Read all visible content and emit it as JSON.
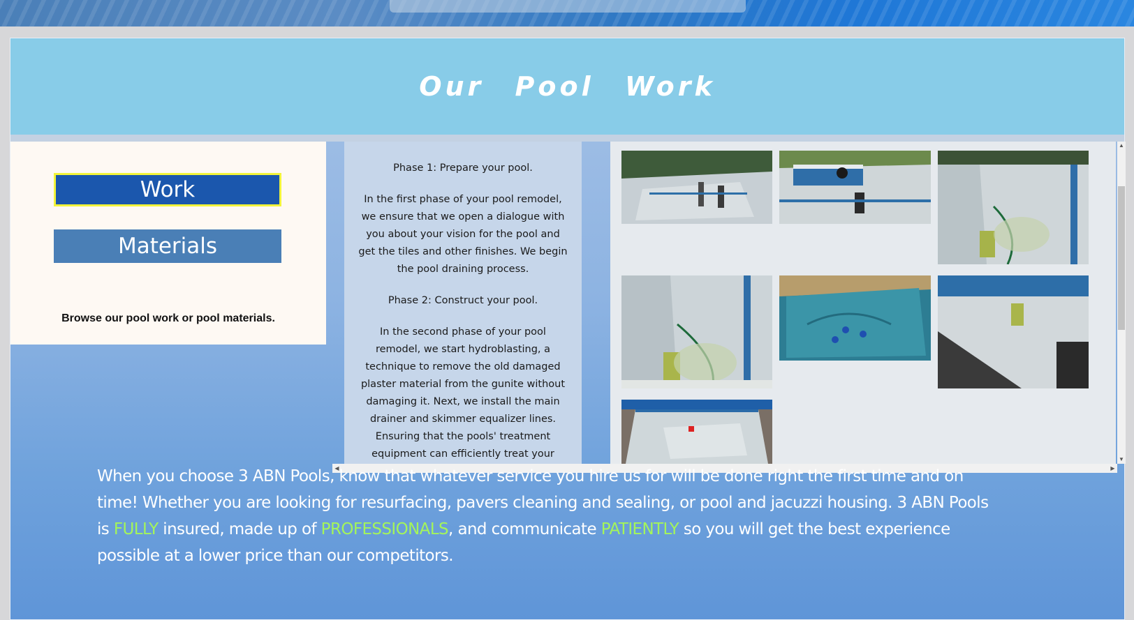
{
  "hero": {
    "title": "Our Pool Work"
  },
  "left": {
    "buttons": {
      "work": "Work",
      "materials": "Materials"
    },
    "browse_text": "Browse our pool work or pool materials."
  },
  "phases": [
    {
      "title": "Phase 1: Prepare your pool.",
      "body": "In the first phase of your pool remodel, we ensure that we open a dialogue with you about your vision for the pool and get the tiles and other finishes. We begin the pool draining process."
    },
    {
      "title": "Phase 2: Construct your pool.",
      "body": "In the second phase of your pool remodel, we start hydroblasting, a technique to remove the old damaged plaster material from the gunite without damaging it. Next, we install the main drainer and skimmer equalizer lines. Ensuring that the pools' treatment equipment can efficiently treat your pool's water."
    }
  ],
  "bottom": {
    "p1": "When you choose 3 ABN Pools, know that whatever service you hire us for will be done right the first time and on time! Whether you are looking for resurfacing, pavers cleaning and sealing, or pool and jacuzzi housing. 3 ABN Pools is ",
    "h1": "FULLY",
    "p2": " insured, made up of ",
    "h2": "PROFESSIONALS",
    "p3": ", and communicate ",
    "h3": "PATIENTLY",
    "p4": " so you will get the best experience possible at a lower price than our competitors."
  },
  "colors": {
    "hero": "#88cce8",
    "work_button": "#1b57ad",
    "materials_button": "#4a7fb6",
    "highlight": "#a4f55a"
  },
  "icons": {
    "scroll_up": "triangle-up",
    "scroll_down": "triangle-down",
    "scroll_left": "triangle-left",
    "scroll_right": "triangle-right"
  }
}
